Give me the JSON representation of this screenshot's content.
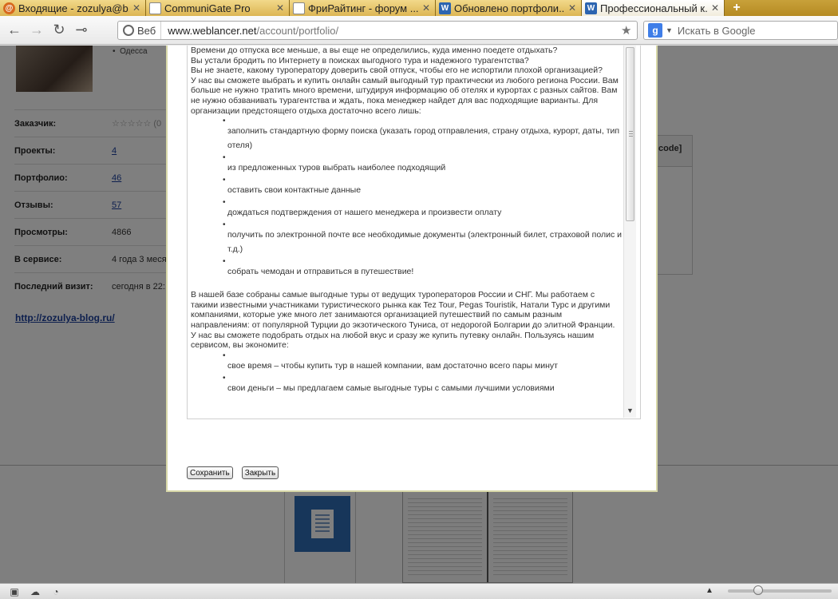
{
  "tabs": [
    {
      "title": "Входящие - zozulya@b...",
      "favicon": "mail-icon",
      "active": false
    },
    {
      "title": "CommuniGate Pro",
      "favicon": "page-icon",
      "active": false
    },
    {
      "title": "ФриРайтинг - форум ...",
      "favicon": "page-icon",
      "active": false
    },
    {
      "title": "Обновлено портфоли...",
      "favicon": "W",
      "active": false
    },
    {
      "title": "Профессиональный к...",
      "favicon": "W",
      "active": true
    }
  ],
  "addressbar": {
    "site_label": "Веб",
    "url_host": "www.weblancer.net",
    "url_path": "/account/portfolio/"
  },
  "search": {
    "placeholder": "Искать в Google"
  },
  "profile": {
    "city": "Одесса",
    "rows": [
      {
        "label": "Заказчик:",
        "value": "☆☆☆☆☆ (0",
        "link": false
      },
      {
        "label": "Проекты:",
        "value": "4",
        "link": true
      },
      {
        "label": "Портфолио:",
        "value": "46",
        "link": true
      },
      {
        "label": "Отзывы:",
        "value": "57",
        "link": true
      },
      {
        "label": "Просмотры:",
        "value": "4866",
        "link": false
      },
      {
        "label": "В сервисе:",
        "value": "4 года 3 меся",
        "link": false
      },
      {
        "label": "Последний визит:",
        "value": "сегодня в 22:1",
        "link": false
      }
    ],
    "blog_link": "http://zozulya-blog.ru/",
    "right_box_label": "code]"
  },
  "editor": {
    "intro": [
      "Времени до отпуска все меньше, а вы еще не определились, куда именно поедете отдыхать?",
      "Вы устали бродить по Интернету в поисках выгодного тура и надежного турагентства?",
      "Вы не знаете, какому туроператору доверить свой отпуск, чтобы его не испортили плохой организацией?",
      "У нас вы сможете выбрать и купить онлайн самый выгодный тур практически из любого региона России. Вам больше не нужно тратить много времени, штудируя информацию об отелях и курортах с разных сайтов. Вам не нужно обзванивать турагентства и ждать, пока менеджер найдет для вас подходящие варианты. Для организации предстоящего отдыха достаточно всего лишь:"
    ],
    "steps": [
      "заполнить стандартную форму поиска (указать город отправления, страну отдыха, курорт, даты, тип отеля)",
      "из предложенных туров выбрать наиболее подходящий",
      "оставить свои контактные данные",
      "дождаться подтверждения от нашего менеджера и произвести оплату",
      "получить по электронной почте все необходимые документы (электронный билет, страховой полис и т.д.)",
      "собрать чемодан и отправиться в путешествие!"
    ],
    "middle": [
      "В нашей базе собраны самые выгодные туры от ведущих туроператоров России и СНГ. Мы работаем с такими известными участниками туристического рынка как Tez Tour, Pegas Touristik, Натали Турс и другими компаниями, которые уже много лет занимаются организацией путешествий по самым разным направлениям: от популярной Турции до экзотического Туниса, от недорогой Болгарии до элитной Франции.",
      "У нас вы сможете подобрать отдых на любой вкус и сразу же купить путевку онлайн. Пользуясь нашим сервисом, вы экономите:"
    ],
    "savings": [
      "свое время – чтобы купить тур в нашей компании, вам достаточно всего пары минут",
      "свои деньги – мы предлагаем самые выгодные туры с самыми лучшими условиями"
    ]
  },
  "buttons": {
    "save": "Сохранить",
    "close": "Закрыть"
  }
}
